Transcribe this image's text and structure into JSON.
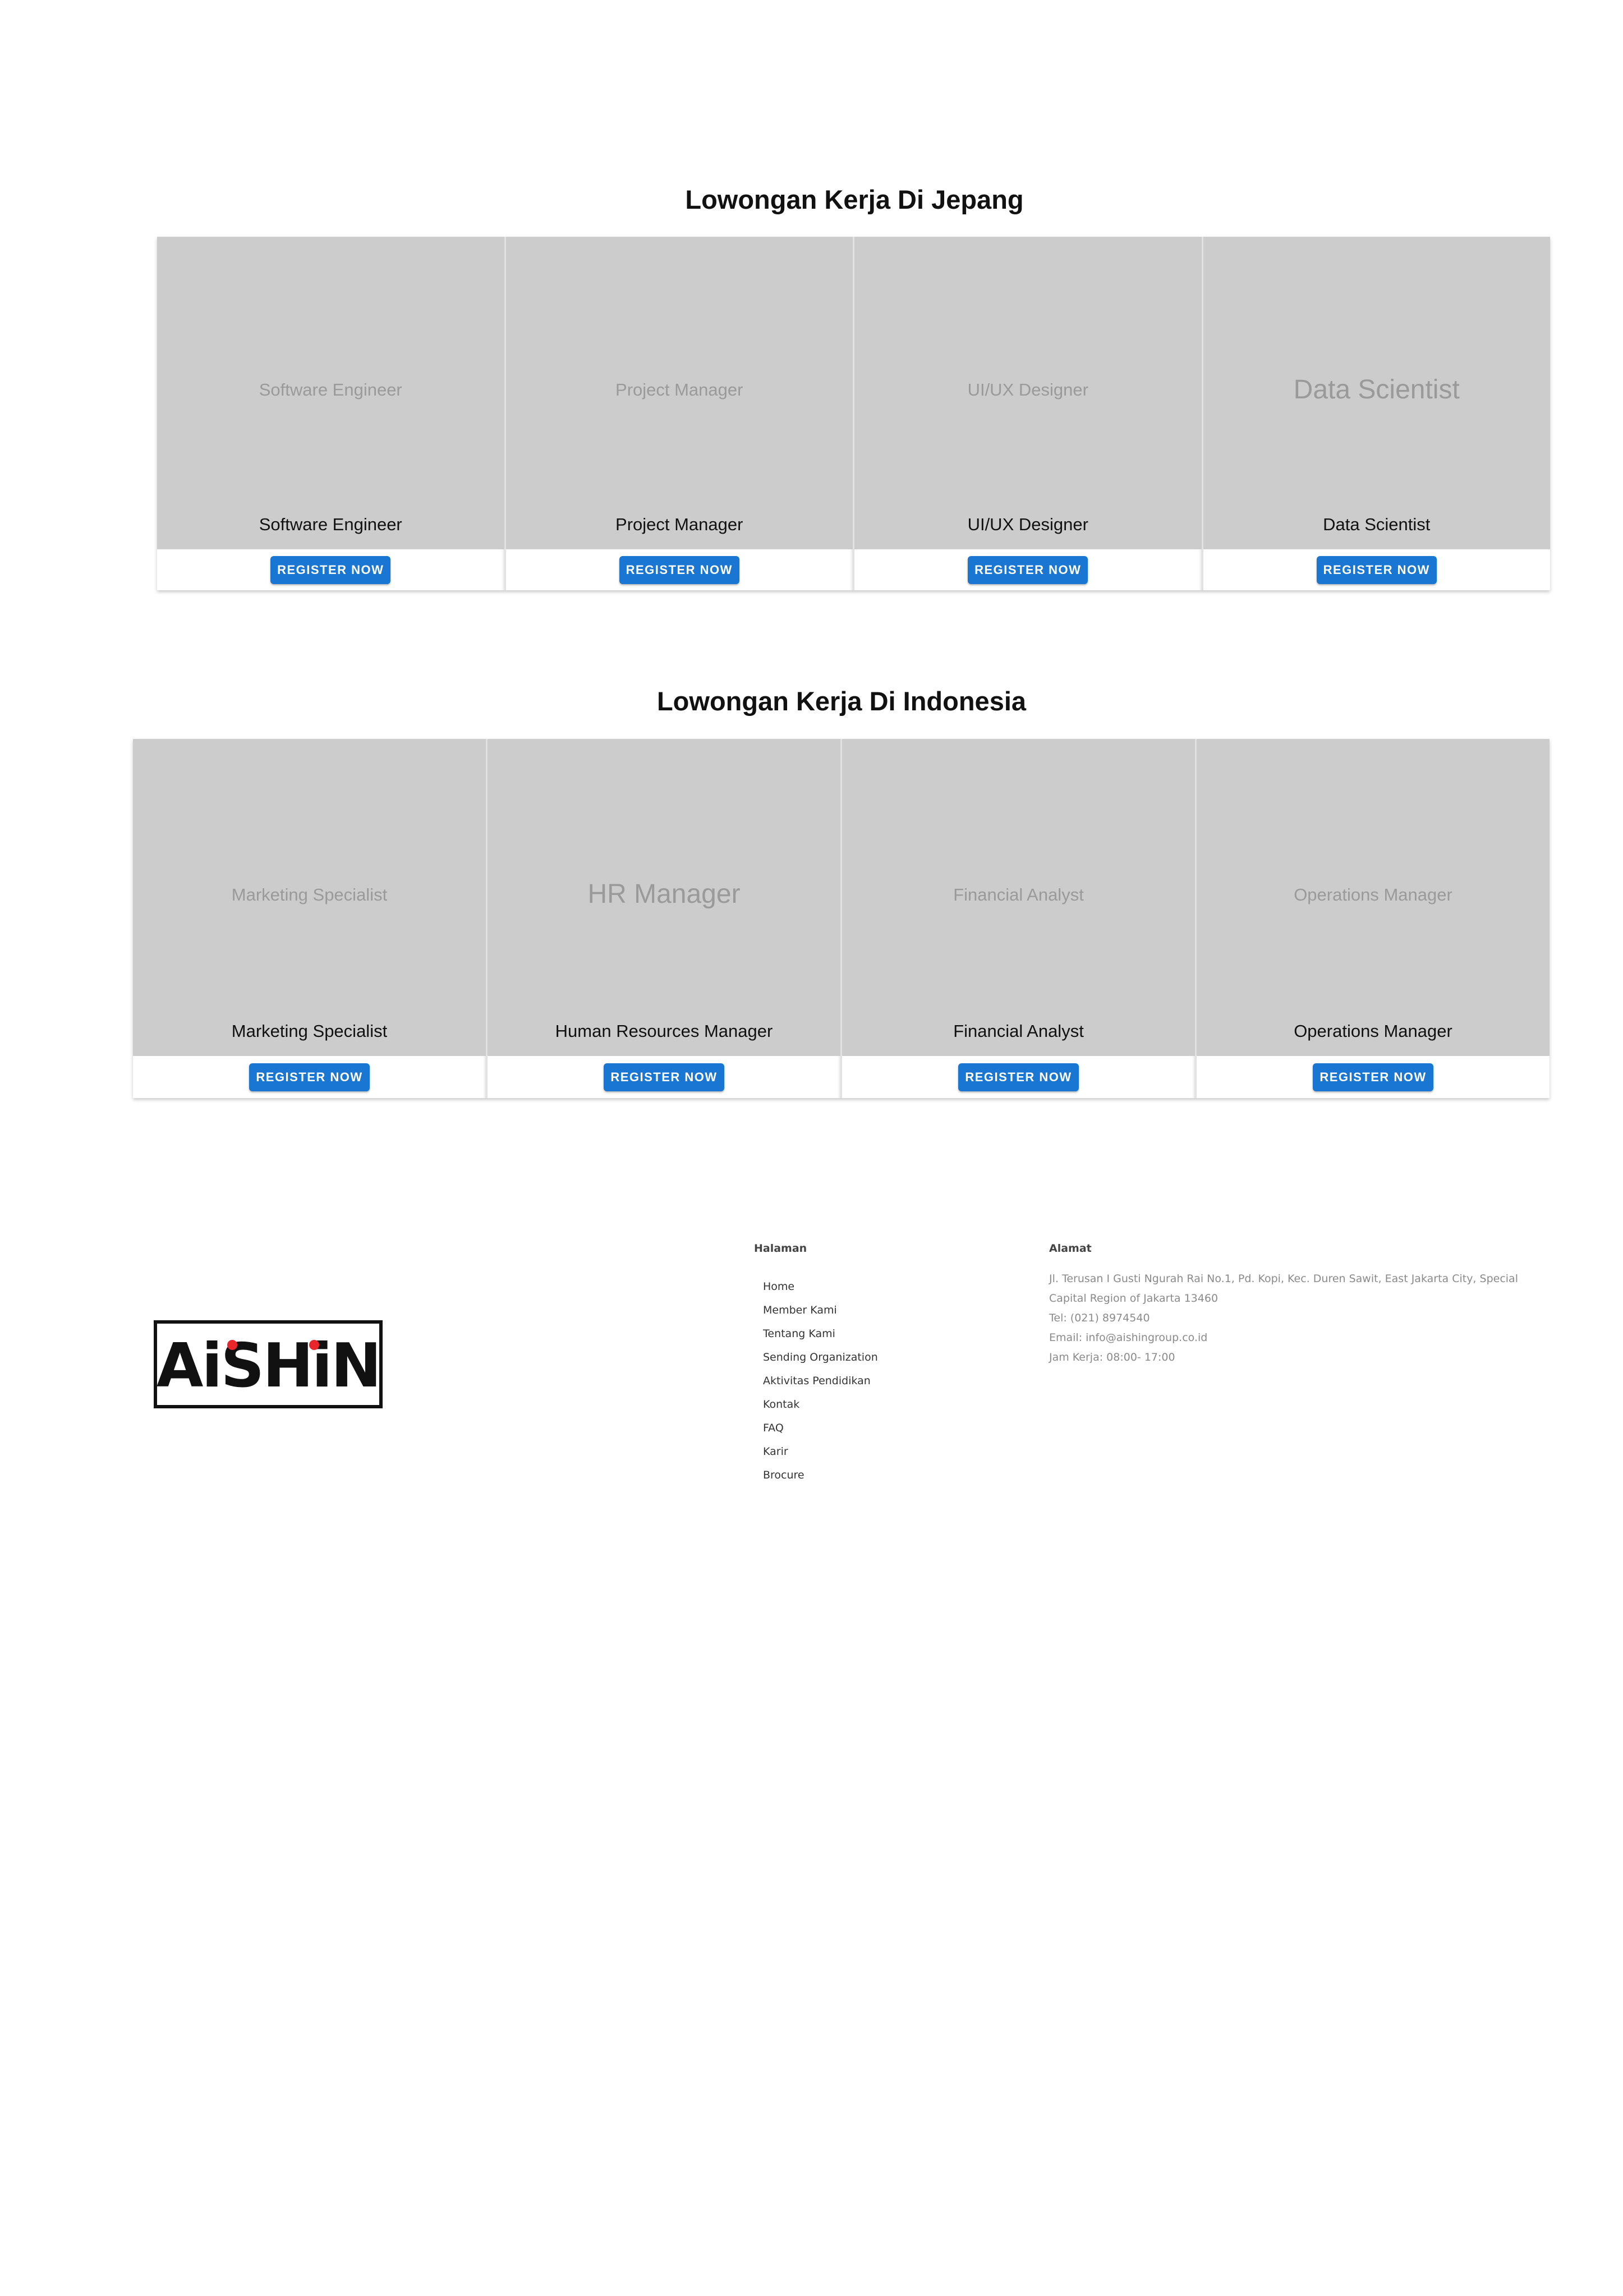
{
  "sections": {
    "japan": {
      "title": "Lowongan Kerja Di Jepang",
      "cards": [
        {
          "image_text": "Software Engineer",
          "title": "Software Engineer",
          "button": "REGISTER NOW"
        },
        {
          "image_text": "Project Manager",
          "title": "Project Manager",
          "button": "REGISTER NOW"
        },
        {
          "image_text": "UI/UX Designer",
          "title": "UI/UX Designer",
          "button": "REGISTER NOW"
        },
        {
          "image_text": "Data Scientist",
          "title": "Data Scientist",
          "button": "REGISTER NOW"
        }
      ]
    },
    "indonesia": {
      "title": "Lowongan Kerja Di Indonesia",
      "cards": [
        {
          "image_text": "Marketing Specialist",
          "title": "Marketing Specialist",
          "button": "REGISTER NOW"
        },
        {
          "image_text": "HR Manager",
          "title": "Human Resources Manager",
          "button": "REGISTER NOW"
        },
        {
          "image_text": "Financial Analyst",
          "title": "Financial Analyst",
          "button": "REGISTER NOW"
        },
        {
          "image_text": "Operations Manager",
          "title": "Operations Manager",
          "button": "REGISTER NOW"
        }
      ]
    }
  },
  "footer": {
    "logo_text": "AiSHiN",
    "halaman": {
      "heading": "Halaman",
      "links": [
        "Home",
        "Member Kami",
        "Tentang Kami",
        "Sending Organization",
        "Aktivitas Pendidikan",
        "Kontak",
        "FAQ",
        "Karir",
        "Brocure"
      ]
    },
    "alamat": {
      "heading": "Alamat",
      "address": "Jl. Terusan I Gusti Ngurah Rai No.1, Pd. Kopi, Kec. Duren Sawit, East Jakarta City, Special Capital Region of Jakarta 13460",
      "tel": "Tel: (021) 8974540",
      "email": "Email: info@aishingroup.co.id",
      "hours": "Jam Kerja: 08:00- 17:00"
    }
  },
  "colors": {
    "button": "#1976d2",
    "card_media": "#cccccc",
    "logo": "#111111",
    "logo_accent": "#e8262b"
  }
}
